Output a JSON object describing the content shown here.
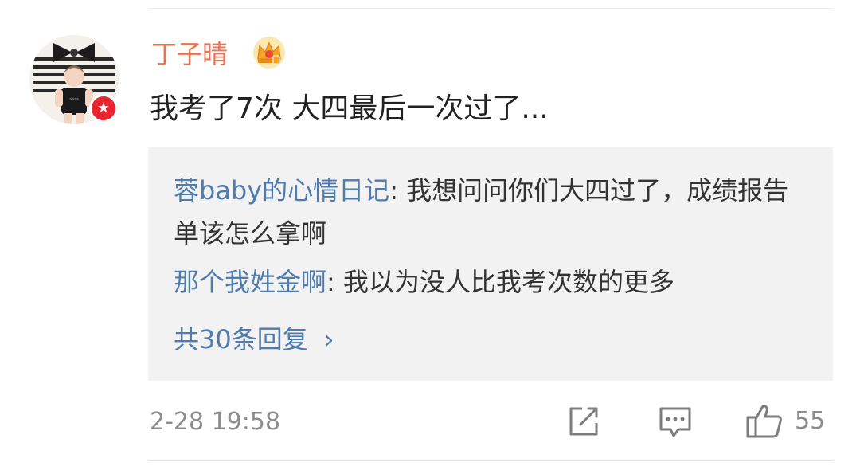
{
  "comment": {
    "username": "丁子晴",
    "text": "我考了7次 大四最后一次过了...",
    "timestamp": "2-28 19:58",
    "like_count": "55"
  },
  "replies": [
    {
      "author": "蓉baby的心情日记",
      "separator": ": ",
      "text": "我想问问你们大四过了，成绩报告单该怎么拿啊"
    },
    {
      "author": "那个我姓金啊",
      "separator": ": ",
      "text": "我以为没人比我考次数的更多"
    }
  ],
  "more_replies": {
    "label": "共30条回复",
    "chevron": "›"
  },
  "icons": {
    "avatar": "avatar-photo",
    "badge": "verified-star-icon",
    "vip": "vip-crown-icon",
    "share": "share-icon",
    "comment": "comment-icon",
    "like": "thumbs-up-icon"
  },
  "colors": {
    "username": "#eb7350",
    "link": "#4f7cae",
    "badge": "#e8252f",
    "reply_bg": "#f2f2f2",
    "meta": "#8c8c8c"
  }
}
